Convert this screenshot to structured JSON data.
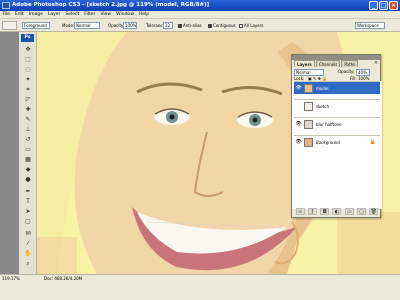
{
  "window": {
    "title": "Adobe Photoshop CS3 - [sketch 2.jpg @ 119% (model, RGB/8#)]",
    "controls": [
      "_",
      "□",
      "×"
    ]
  },
  "menu": [
    "File",
    "Edit",
    "Image",
    "Layer",
    "Select",
    "Filter",
    "View",
    "Window",
    "Help"
  ],
  "options": {
    "sample_label": "Foreground",
    "mode_label": "Mode:",
    "mode_value": "Normal",
    "opacity_label": "Opacity:",
    "opacity_value": "100%",
    "tolerance_label": "Tolerance:",
    "tolerance_value": "32",
    "antialias_label": "Anti-alias",
    "contiguous_label": "Contiguous",
    "all_layers_label": "All Layers",
    "workspace_label": "Workspace"
  },
  "toolbox": {
    "badge": "Ps"
  },
  "layers_panel": {
    "tabs": [
      "Layers",
      "Channels",
      "Paths"
    ],
    "blend_mode": "Normal",
    "opacity_label": "Opacity:",
    "opacity_value": "40%",
    "lock_label": "Lock:",
    "fill_label": "Fill:",
    "fill_value": "100%",
    "layers": [
      {
        "name": "model",
        "selected": true
      },
      {
        "name": "sketch",
        "selected": false
      },
      {
        "name": "blur halftone",
        "selected": false
      },
      {
        "name": "Background",
        "selected": false,
        "locked": true
      }
    ]
  },
  "status": {
    "zoom": "119.17%",
    "doc": "Doc: 468.2K/4.20M"
  },
  "colors": {
    "title_bar": "#1d54c9",
    "chrome": "#ece9d8",
    "canvas_tint": "#f8f2a6",
    "selected_layer": "#316ac5"
  }
}
